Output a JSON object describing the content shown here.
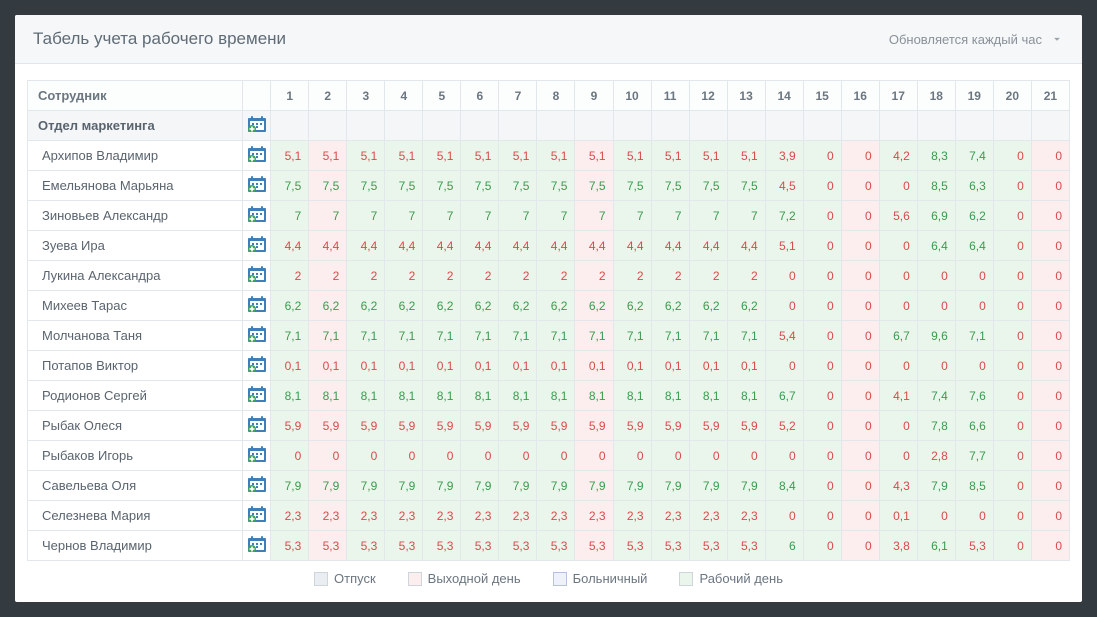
{
  "header": {
    "title": "Табель учета рабочего времени",
    "subtitle": "Обновляется каждый час"
  },
  "columns": {
    "employee_header": "Сотрудник",
    "days": [
      "1",
      "2",
      "3",
      "4",
      "5",
      "6",
      "7",
      "8",
      "9",
      "10",
      "11",
      "12",
      "13",
      "14",
      "15",
      "16",
      "17",
      "18",
      "19",
      "20",
      "21"
    ]
  },
  "group": {
    "name": "Отдел маркетинга"
  },
  "day_types": [
    "work",
    "off",
    "work",
    "work",
    "work",
    "work",
    "work",
    "work",
    "off",
    "work",
    "work",
    "work",
    "work",
    "work",
    "work",
    "off",
    "work",
    "work",
    "work",
    "work",
    "off"
  ],
  "employees": [
    {
      "name": "Архипов Владимир",
      "values": [
        "5,1",
        "5,1",
        "5,1",
        "5,1",
        "5,1",
        "5,1",
        "5,1",
        "5,1",
        "5,1",
        "5,1",
        "5,1",
        "5,1",
        "5,1",
        "3,9",
        "0",
        "0",
        "4,2",
        "8,3",
        "7,4",
        "0",
        "0"
      ],
      "colors": [
        "r",
        "r",
        "r",
        "r",
        "r",
        "r",
        "r",
        "r",
        "r",
        "r",
        "r",
        "r",
        "r",
        "r",
        "r",
        "r",
        "r",
        "g",
        "g",
        "r",
        "r"
      ]
    },
    {
      "name": "Емельянова Марьяна",
      "values": [
        "7,5",
        "7,5",
        "7,5",
        "7,5",
        "7,5",
        "7,5",
        "7,5",
        "7,5",
        "7,5",
        "7,5",
        "7,5",
        "7,5",
        "7,5",
        "4,5",
        "0",
        "0",
        "0",
        "8,5",
        "6,3",
        "0",
        "0"
      ],
      "colors": [
        "g",
        "g",
        "g",
        "g",
        "g",
        "g",
        "g",
        "g",
        "g",
        "g",
        "g",
        "g",
        "g",
        "r",
        "r",
        "r",
        "r",
        "g",
        "g",
        "r",
        "r"
      ]
    },
    {
      "name": "Зиновьев Александр",
      "values": [
        "7",
        "7",
        "7",
        "7",
        "7",
        "7",
        "7",
        "7",
        "7",
        "7",
        "7",
        "7",
        "7",
        "7,2",
        "0",
        "0",
        "5,6",
        "6,9",
        "6,2",
        "0",
        "0"
      ],
      "colors": [
        "g",
        "g",
        "g",
        "g",
        "g",
        "g",
        "g",
        "g",
        "g",
        "g",
        "g",
        "g",
        "g",
        "g",
        "r",
        "r",
        "r",
        "g",
        "g",
        "r",
        "r"
      ]
    },
    {
      "name": "Зуева Ира",
      "values": [
        "4,4",
        "4,4",
        "4,4",
        "4,4",
        "4,4",
        "4,4",
        "4,4",
        "4,4",
        "4,4",
        "4,4",
        "4,4",
        "4,4",
        "4,4",
        "5,1",
        "0",
        "0",
        "0",
        "6,4",
        "6,4",
        "0",
        "0"
      ],
      "colors": [
        "r",
        "r",
        "r",
        "r",
        "r",
        "r",
        "r",
        "r",
        "r",
        "r",
        "r",
        "r",
        "r",
        "r",
        "r",
        "r",
        "r",
        "g",
        "g",
        "r",
        "r"
      ]
    },
    {
      "name": "Лукина Александра",
      "values": [
        "2",
        "2",
        "2",
        "2",
        "2",
        "2",
        "2",
        "2",
        "2",
        "2",
        "2",
        "2",
        "2",
        "0",
        "0",
        "0",
        "0",
        "0",
        "0",
        "0",
        "0"
      ],
      "colors": [
        "r",
        "r",
        "r",
        "r",
        "r",
        "r",
        "r",
        "r",
        "r",
        "r",
        "r",
        "r",
        "r",
        "r",
        "r",
        "r",
        "r",
        "r",
        "r",
        "r",
        "r"
      ]
    },
    {
      "name": "Михеев Тарас",
      "values": [
        "6,2",
        "6,2",
        "6,2",
        "6,2",
        "6,2",
        "6,2",
        "6,2",
        "6,2",
        "6,2",
        "6,2",
        "6,2",
        "6,2",
        "6,2",
        "0",
        "0",
        "0",
        "0",
        "0",
        "0",
        "0",
        "0"
      ],
      "colors": [
        "g",
        "g",
        "g",
        "g",
        "g",
        "g",
        "g",
        "g",
        "g",
        "g",
        "g",
        "g",
        "g",
        "r",
        "r",
        "r",
        "r",
        "r",
        "r",
        "r",
        "r"
      ]
    },
    {
      "name": "Молчанова Таня",
      "values": [
        "7,1",
        "7,1",
        "7,1",
        "7,1",
        "7,1",
        "7,1",
        "7,1",
        "7,1",
        "7,1",
        "7,1",
        "7,1",
        "7,1",
        "7,1",
        "5,4",
        "0",
        "0",
        "6,7",
        "9,6",
        "7,1",
        "0",
        "0"
      ],
      "colors": [
        "g",
        "g",
        "g",
        "g",
        "g",
        "g",
        "g",
        "g",
        "g",
        "g",
        "g",
        "g",
        "g",
        "r",
        "r",
        "r",
        "g",
        "g",
        "g",
        "r",
        "r"
      ]
    },
    {
      "name": "Потапов Виктор",
      "values": [
        "0,1",
        "0,1",
        "0,1",
        "0,1",
        "0,1",
        "0,1",
        "0,1",
        "0,1",
        "0,1",
        "0,1",
        "0,1",
        "0,1",
        "0,1",
        "0",
        "0",
        "0",
        "0",
        "0",
        "0",
        "0",
        "0"
      ],
      "colors": [
        "r",
        "r",
        "r",
        "r",
        "r",
        "r",
        "r",
        "r",
        "r",
        "r",
        "r",
        "r",
        "r",
        "r",
        "r",
        "r",
        "r",
        "r",
        "r",
        "r",
        "r"
      ]
    },
    {
      "name": "Родионов Сергей",
      "values": [
        "8,1",
        "8,1",
        "8,1",
        "8,1",
        "8,1",
        "8,1",
        "8,1",
        "8,1",
        "8,1",
        "8,1",
        "8,1",
        "8,1",
        "8,1",
        "6,7",
        "0",
        "0",
        "4,1",
        "7,4",
        "7,6",
        "0",
        "0"
      ],
      "colors": [
        "g",
        "g",
        "g",
        "g",
        "g",
        "g",
        "g",
        "g",
        "g",
        "g",
        "g",
        "g",
        "g",
        "g",
        "r",
        "r",
        "r",
        "g",
        "g",
        "r",
        "r"
      ]
    },
    {
      "name": "Рыбак Олеся",
      "values": [
        "5,9",
        "5,9",
        "5,9",
        "5,9",
        "5,9",
        "5,9",
        "5,9",
        "5,9",
        "5,9",
        "5,9",
        "5,9",
        "5,9",
        "5,9",
        "5,2",
        "0",
        "0",
        "0",
        "7,8",
        "6,6",
        "0",
        "0"
      ],
      "colors": [
        "r",
        "r",
        "r",
        "r",
        "r",
        "r",
        "r",
        "r",
        "r",
        "r",
        "r",
        "r",
        "r",
        "r",
        "r",
        "r",
        "r",
        "g",
        "g",
        "r",
        "r"
      ]
    },
    {
      "name": "Рыбаков Игорь",
      "values": [
        "0",
        "0",
        "0",
        "0",
        "0",
        "0",
        "0",
        "0",
        "0",
        "0",
        "0",
        "0",
        "0",
        "0",
        "0",
        "0",
        "0",
        "2,8",
        "7,7",
        "0",
        "0"
      ],
      "colors": [
        "r",
        "r",
        "r",
        "r",
        "r",
        "r",
        "r",
        "r",
        "r",
        "r",
        "r",
        "r",
        "r",
        "r",
        "r",
        "r",
        "r",
        "r",
        "g",
        "r",
        "r"
      ]
    },
    {
      "name": "Савельева Оля",
      "values": [
        "7,9",
        "7,9",
        "7,9",
        "7,9",
        "7,9",
        "7,9",
        "7,9",
        "7,9",
        "7,9",
        "7,9",
        "7,9",
        "7,9",
        "7,9",
        "8,4",
        "0",
        "0",
        "4,3",
        "7,9",
        "8,5",
        "0",
        "0"
      ],
      "colors": [
        "g",
        "g",
        "g",
        "g",
        "g",
        "g",
        "g",
        "g",
        "g",
        "g",
        "g",
        "g",
        "g",
        "g",
        "r",
        "r",
        "r",
        "g",
        "g",
        "r",
        "r"
      ]
    },
    {
      "name": "Селезнева Мария",
      "values": [
        "2,3",
        "2,3",
        "2,3",
        "2,3",
        "2,3",
        "2,3",
        "2,3",
        "2,3",
        "2,3",
        "2,3",
        "2,3",
        "2,3",
        "2,3",
        "0",
        "0",
        "0",
        "0,1",
        "0",
        "0",
        "0",
        "0"
      ],
      "colors": [
        "r",
        "r",
        "r",
        "r",
        "r",
        "r",
        "r",
        "r",
        "r",
        "r",
        "r",
        "r",
        "r",
        "r",
        "r",
        "r",
        "r",
        "r",
        "r",
        "r",
        "r"
      ]
    },
    {
      "name": "Чернов Владимир",
      "values": [
        "5,3",
        "5,3",
        "5,3",
        "5,3",
        "5,3",
        "5,3",
        "5,3",
        "5,3",
        "5,3",
        "5,3",
        "5,3",
        "5,3",
        "5,3",
        "6",
        "0",
        "0",
        "3,8",
        "6,1",
        "5,3",
        "0",
        "0"
      ],
      "colors": [
        "r",
        "r",
        "r",
        "r",
        "r",
        "r",
        "r",
        "r",
        "r",
        "r",
        "r",
        "r",
        "r",
        "g",
        "r",
        "r",
        "r",
        "g",
        "r",
        "r",
        "r"
      ]
    }
  ],
  "legend": {
    "vacation": "Отпуск",
    "dayoff": "Выходной день",
    "sick": "Больничный",
    "workday": "Рабочий день"
  }
}
